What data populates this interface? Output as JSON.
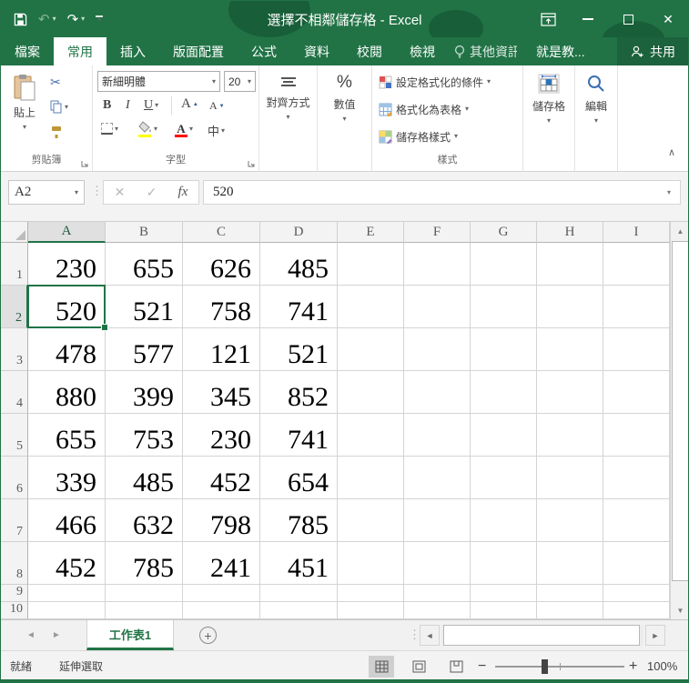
{
  "colors": {
    "accent_green": "#217346",
    "highlight_yellow": "#ffff00",
    "font_red": "#ff0000"
  },
  "window": {
    "title": "選擇不相鄰儲存格 - Excel"
  },
  "ribbon_tabs": {
    "file": "檔案",
    "items": [
      "常用",
      "插入",
      "版面配置",
      "公式",
      "資料",
      "校閱",
      "檢視"
    ],
    "tellme": "其他資訊",
    "addin": "就是教...",
    "share": "共用"
  },
  "ribbon": {
    "clipboard": {
      "group": "剪貼簿",
      "paste": "貼上"
    },
    "font": {
      "group": "字型",
      "name": "新細明體",
      "size": "20",
      "bold": "B",
      "italic": "I",
      "underline": "U",
      "grow": "A",
      "shrink": "A",
      "font_color": "A",
      "phonetic": "中"
    },
    "alignment": {
      "group": "對齊方式"
    },
    "number": {
      "group": "數值",
      "percent": "%"
    },
    "styles": {
      "group": "樣式",
      "conditional": "設定格式化的條件",
      "format_table": "格式化為表格",
      "cell_styles": "儲存格樣式"
    },
    "cells": {
      "group": "儲存格"
    },
    "editing": {
      "group": "編輯"
    }
  },
  "formula_bar": {
    "name_box": "A2",
    "cancel": "✕",
    "enter": "✓",
    "fx": "fx",
    "value": "520"
  },
  "grid": {
    "columns": [
      "A",
      "B",
      "C",
      "D",
      "E",
      "F",
      "G",
      "H",
      "I"
    ],
    "row_numbers": [
      "1",
      "2",
      "3",
      "4",
      "5",
      "6",
      "7",
      "8",
      "9",
      "10"
    ],
    "active": {
      "row": 2,
      "col": "A"
    },
    "data": [
      [
        "230",
        "655",
        "626",
        "485",
        "",
        "",
        "",
        "",
        ""
      ],
      [
        "520",
        "521",
        "758",
        "741",
        "",
        "",
        "",
        "",
        ""
      ],
      [
        "478",
        "577",
        "121",
        "521",
        "",
        "",
        "",
        "",
        ""
      ],
      [
        "880",
        "399",
        "345",
        "852",
        "",
        "",
        "",
        "",
        ""
      ],
      [
        "655",
        "753",
        "230",
        "741",
        "",
        "",
        "",
        "",
        ""
      ],
      [
        "339",
        "485",
        "452",
        "654",
        "",
        "",
        "",
        "",
        ""
      ],
      [
        "466",
        "632",
        "798",
        "785",
        "",
        "",
        "",
        "",
        ""
      ],
      [
        "452",
        "785",
        "241",
        "451",
        "",
        "",
        "",
        "",
        ""
      ],
      [
        "",
        "",
        "",
        "",
        "",
        "",
        "",
        "",
        ""
      ],
      [
        "",
        "",
        "",
        "",
        "",
        "",
        "",
        "",
        ""
      ]
    ]
  },
  "sheet_bar": {
    "tab": "工作表1"
  },
  "status_bar": {
    "mode": "就緒",
    "selection": "延伸選取",
    "zoom": "100%"
  },
  "icons": {
    "caret": "▾",
    "up": "▲",
    "down": "▼",
    "left": "◄",
    "right": "►",
    "undo": "↶",
    "redo": "↷",
    "scissors": "✂",
    "close": "✕",
    "collapse": "∧",
    "dots": "⋮",
    "plus": "+",
    "minus": "−"
  }
}
